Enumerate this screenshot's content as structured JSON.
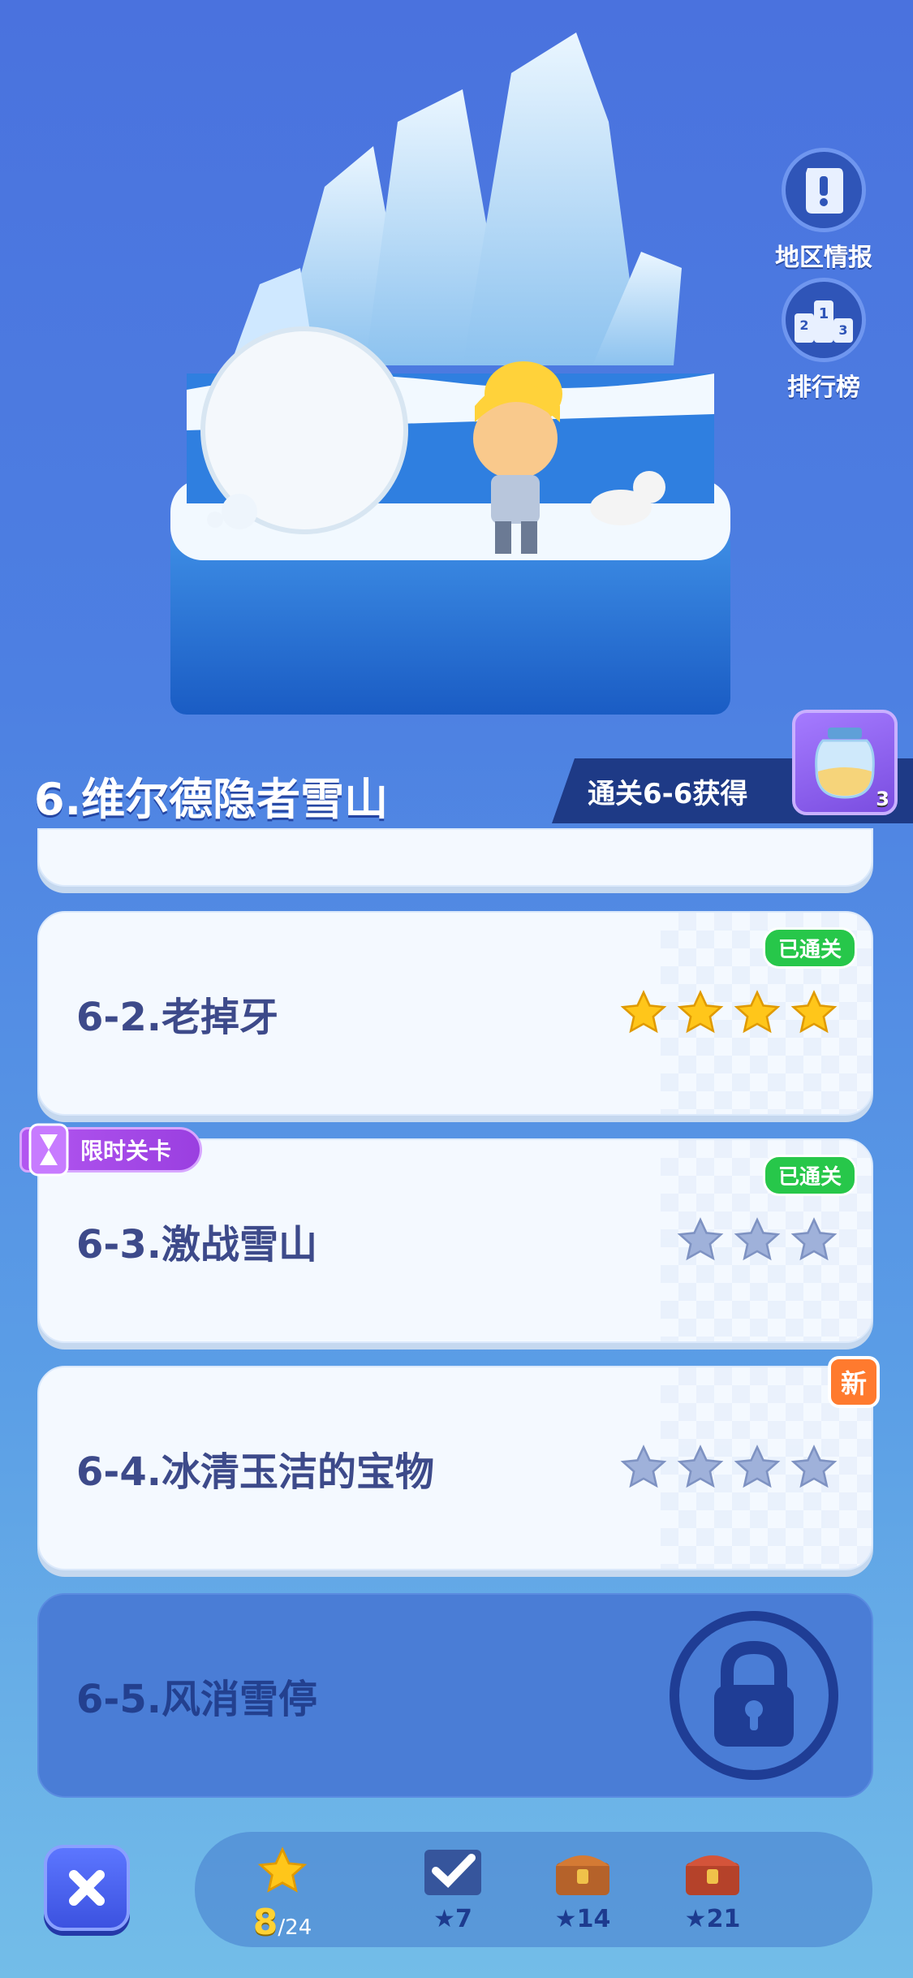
{
  "side_buttons": [
    {
      "label": "地区情报",
      "icon": "scroll-icon"
    },
    {
      "label": "排行榜",
      "icon": "podium-icon"
    }
  ],
  "chapter": {
    "title": "6.维尔德隐者雪山",
    "reward_text": "通关6-6获得",
    "reward_count": "3"
  },
  "levels": [
    {
      "title": "6-2.老掉牙",
      "stars_total": 4,
      "stars_earned": 4,
      "status": "已通关"
    },
    {
      "title": "6-3.激战雪山",
      "stars_total": 3,
      "stars_earned": 0,
      "status": "已通关",
      "tag": "限时关卡"
    },
    {
      "title": "6-4.冰清玉洁的宝物",
      "stars_total": 4,
      "stars_earned": 0,
      "new_badge": "新"
    },
    {
      "title": "6-5.风消雪停",
      "locked": true
    }
  ],
  "bottom": {
    "stars_current": "8",
    "stars_total": "/24",
    "milestones": [
      "7",
      "14",
      "21"
    ]
  },
  "colors": {
    "accent": "#4a72de",
    "clear_green": "#27c74a",
    "star_gold": "#ffc61a",
    "star_empty": "#9fb1da"
  }
}
